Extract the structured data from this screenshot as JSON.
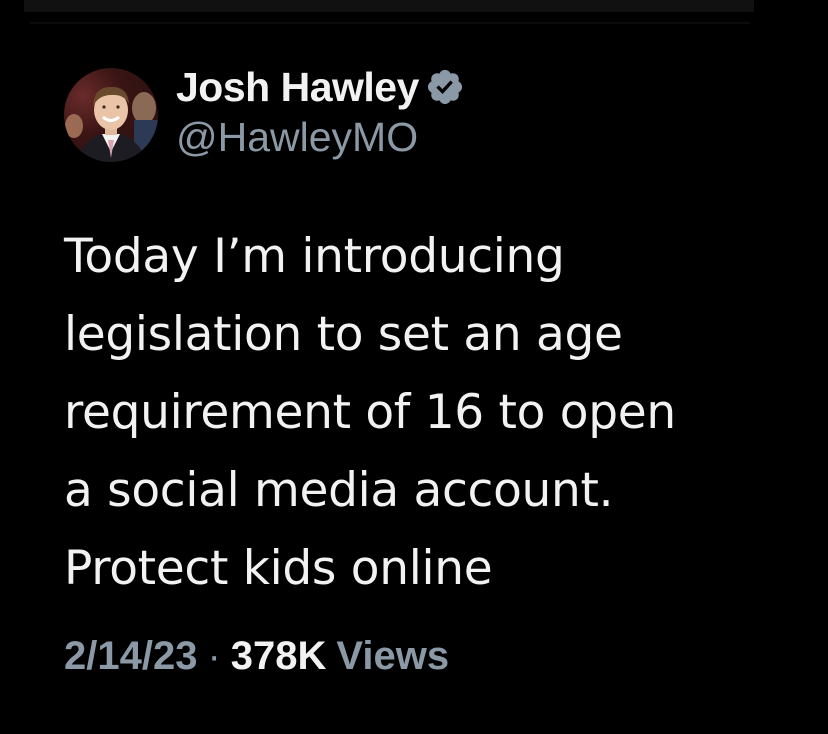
{
  "tweet": {
    "author": {
      "display_name": "Josh Hawley",
      "handle": "@HawleyMO",
      "verified": true,
      "avatar_icon": "profile-photo",
      "verified_icon": "verified-badge-icon"
    },
    "text_lines": [
      "Today I’m introducing",
      "legislation to set an age",
      "requirement of 16 to open",
      "a social media account.",
      "Protect kids online"
    ],
    "meta": {
      "date": "2/14/23",
      "separator": "·",
      "views_count": "378K",
      "views_label": "Views"
    }
  },
  "colors": {
    "background": "#000000",
    "primary_text": "#f2f2f2",
    "secondary_text": "#8b98a5",
    "verified_badge": "#8b98a5"
  }
}
